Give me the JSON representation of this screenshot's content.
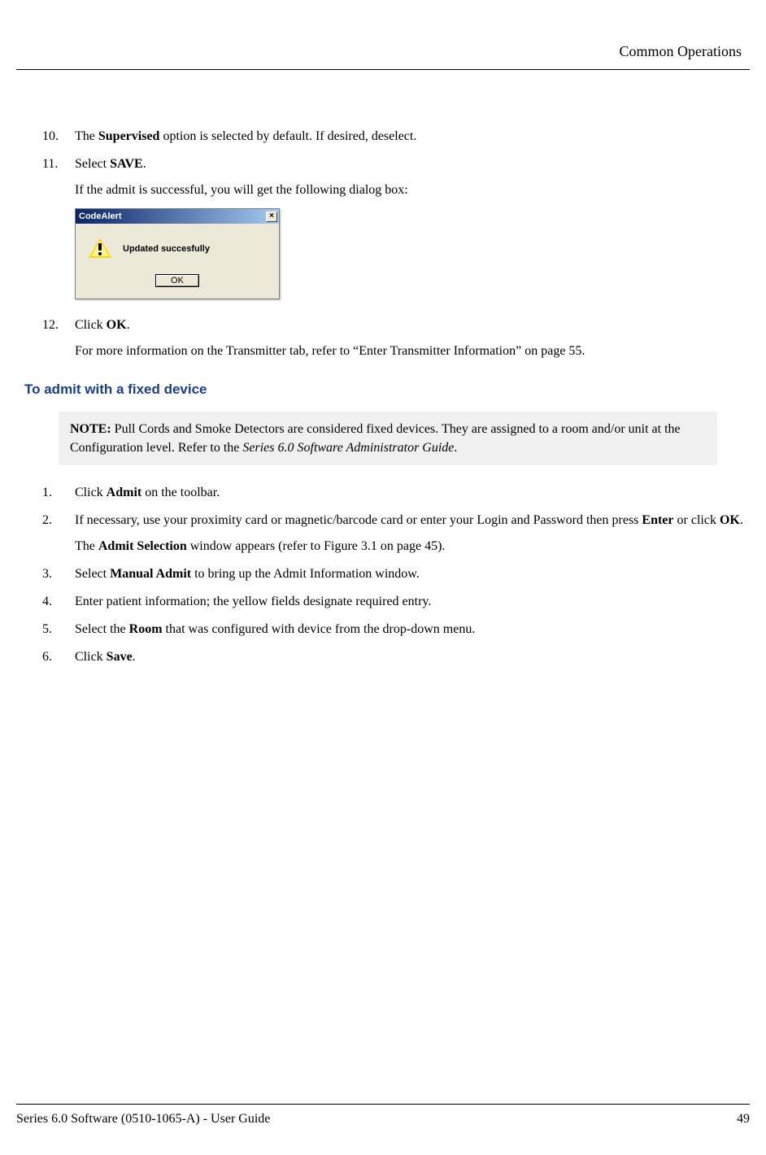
{
  "header": {
    "section_title": "Common Operations"
  },
  "steps_a": {
    "10": {
      "num": "10.",
      "pre": "The ",
      "bold": "Supervised",
      "post": " option is selected by default. If desired, deselect."
    },
    "11": {
      "num": "11.",
      "pre": "Select ",
      "bold": "SAVE",
      "post": ".",
      "followup": "If the admit is successful, you will get the following dialog box:"
    },
    "12": {
      "num": "12.",
      "pre": "Click ",
      "bold": "OK",
      "post": ".",
      "followup": "For more information on the Transmitter tab, refer to “Enter Transmitter Information” on page 55."
    }
  },
  "dialog": {
    "title": "CodeAlert",
    "message": "Updated succesfully",
    "ok": "OK"
  },
  "section_heading": "To admit with a fixed device",
  "note": {
    "label": "NOTE:",
    "text1": " Pull Cords and Smoke Detectors are considered fixed devices. They are assigned to a room and/or unit at the Configuration level. Refer to the ",
    "italic": "Series 6.0 Software Administrator Guide",
    "text2": "."
  },
  "steps_b": {
    "1": {
      "num": "1.",
      "pre": "Click ",
      "bold": "Admit",
      "post": " on the toolbar."
    },
    "2": {
      "num": "2.",
      "pre": "If necessary, use your proximity card or magnetic/barcode card or enter your Login and Password then press ",
      "bold1": "Enter",
      "mid": " or click ",
      "bold2": "OK",
      "post": ".",
      "followup_pre": "The ",
      "followup_bold": "Admit Selection",
      "followup_post": " window appears (refer to Figure 3.1 on page 45)."
    },
    "3": {
      "num": "3.",
      "pre": "Select ",
      "bold": "Manual Admit",
      "post": " to bring up the Admit Information window."
    },
    "4": {
      "num": "4.",
      "text": "Enter patient information; the yellow fields designate required entry."
    },
    "5": {
      "num": "5.",
      "pre": "Select the ",
      "bold": "Room",
      "post": " that was configured with device from the drop-down menu."
    },
    "6": {
      "num": "6.",
      "pre": "Click ",
      "bold": "Save",
      "post": "."
    }
  },
  "footer": {
    "left": "Series 6.0 Software (0510-1065-A) - User Guide",
    "right": "49"
  }
}
